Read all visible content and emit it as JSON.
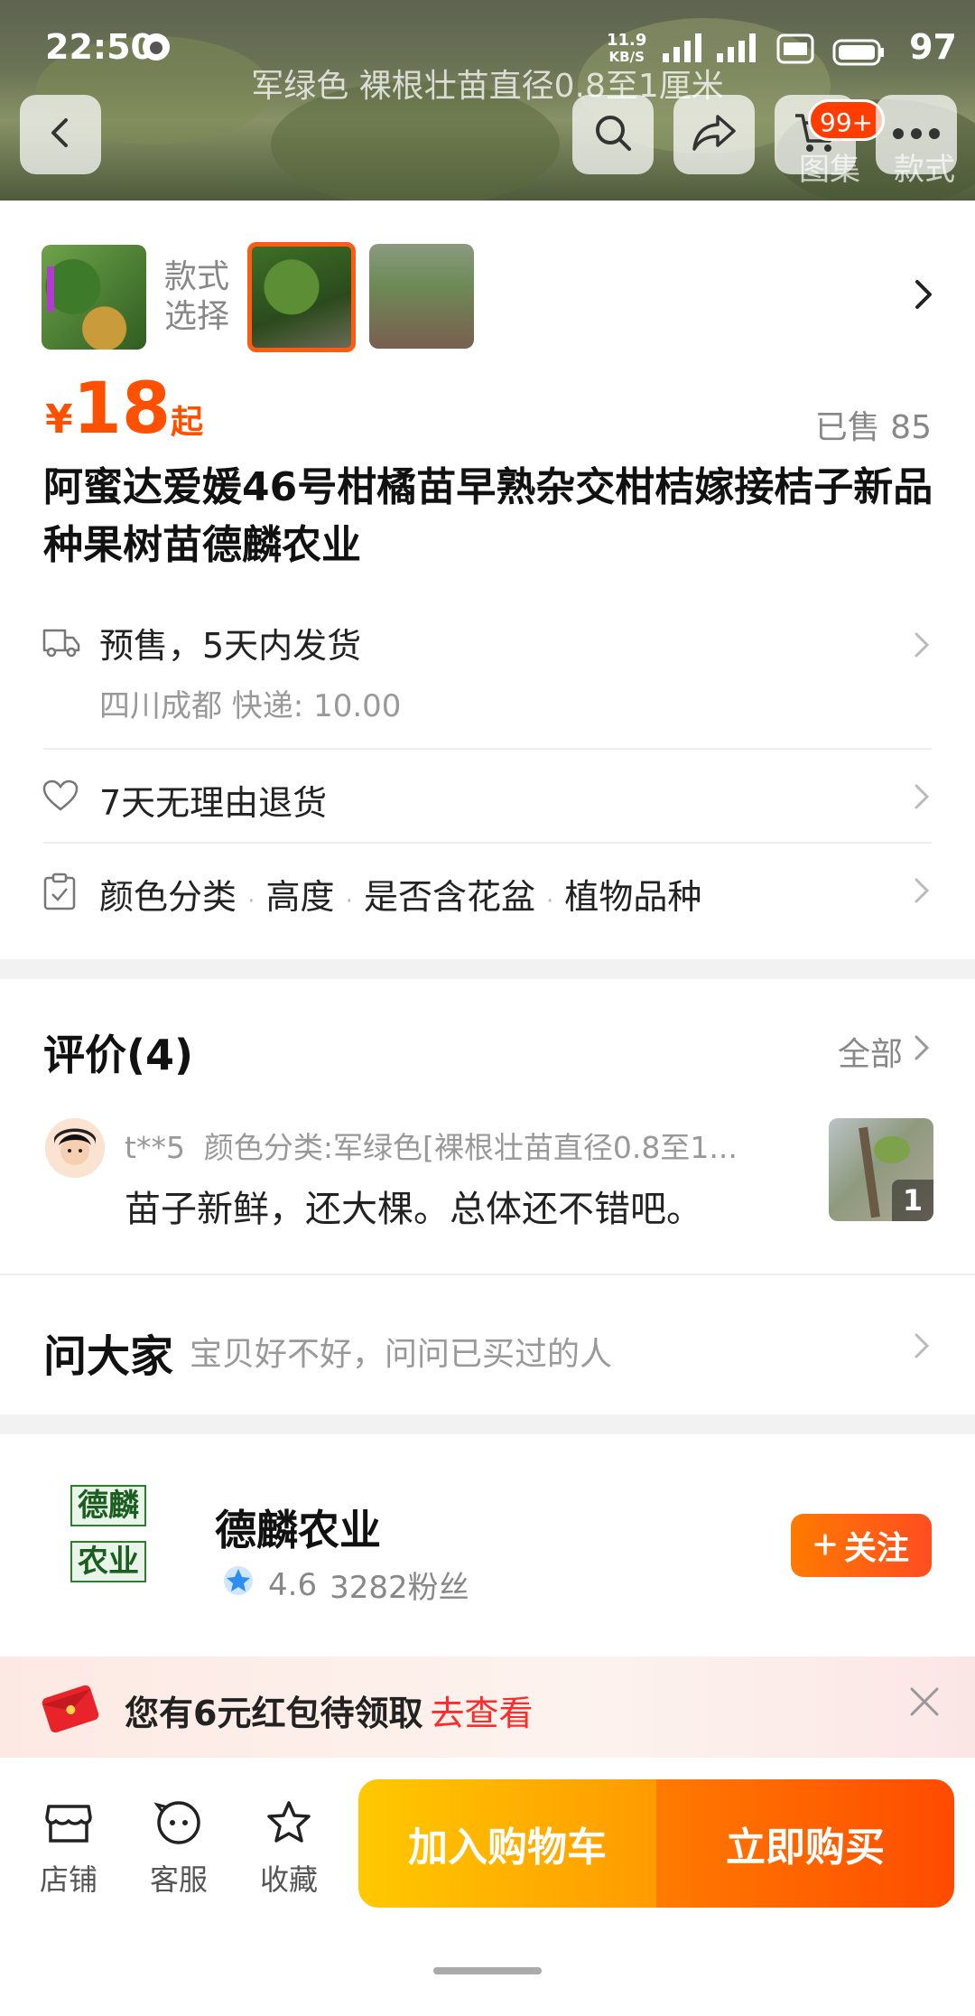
{
  "status_bar": {
    "time": "22:50",
    "net_speed_top": "11.9",
    "net_speed_bottom": "KB/S",
    "battery": "97"
  },
  "header": {
    "variant_overlay": "军绿色 裸根壮苗直径0.8至1厘米",
    "cart_badge": "99+",
    "ghost_tab_1": "图集",
    "ghost_tab_2": "款式",
    "icons": [
      "back-icon",
      "search-icon",
      "share-icon",
      "cart-icon",
      "more-icon"
    ]
  },
  "sku": {
    "label_line1": "款式",
    "label_line2": "选择"
  },
  "price": {
    "currency": "¥",
    "value": "18",
    "suffix": "起",
    "sold": "已售 85"
  },
  "title": "阿蜜达爱媛46号柑橘苗早熟杂交柑桔嫁接桔子新品种果树苗德麟农业",
  "shipping": {
    "main": "预售，5天内发货",
    "sub": "四川成都  快递: 10.00"
  },
  "returns": {
    "text": "7天无理由退货"
  },
  "params": {
    "items": [
      "颜色分类",
      "高度",
      "是否含花盆",
      "植物品种"
    ],
    "sep": "·"
  },
  "reviews": {
    "title": "评价(4)",
    "all_label": "全部",
    "items": [
      {
        "user": "t**5",
        "spec": "颜色分类:军绿色[裸根壮苗直径0.8至1...",
        "text": "苗子新鲜，还大棵。总体还不错吧。",
        "image_count": "1"
      }
    ]
  },
  "ask": {
    "title": "问大家",
    "hint": "宝贝好不好，问问已买过的人"
  },
  "shop": {
    "logo_line1": "德麟",
    "logo_line2": "农业",
    "name": "德麟农业",
    "rating": "4.6",
    "fans": "3282粉丝",
    "follow_label": "关注"
  },
  "coupon": {
    "text": "您有6元红包待领取",
    "link": "去查看"
  },
  "bottom_bar": {
    "store_label": "店铺",
    "service_label": "客服",
    "favorite_label": "收藏",
    "add_to_cart": "加入购物车",
    "buy_now": "立即购买"
  },
  "colors": {
    "accent": "#ff5000",
    "cart_button": "#ffb300",
    "buy_button": "#ff6000"
  }
}
